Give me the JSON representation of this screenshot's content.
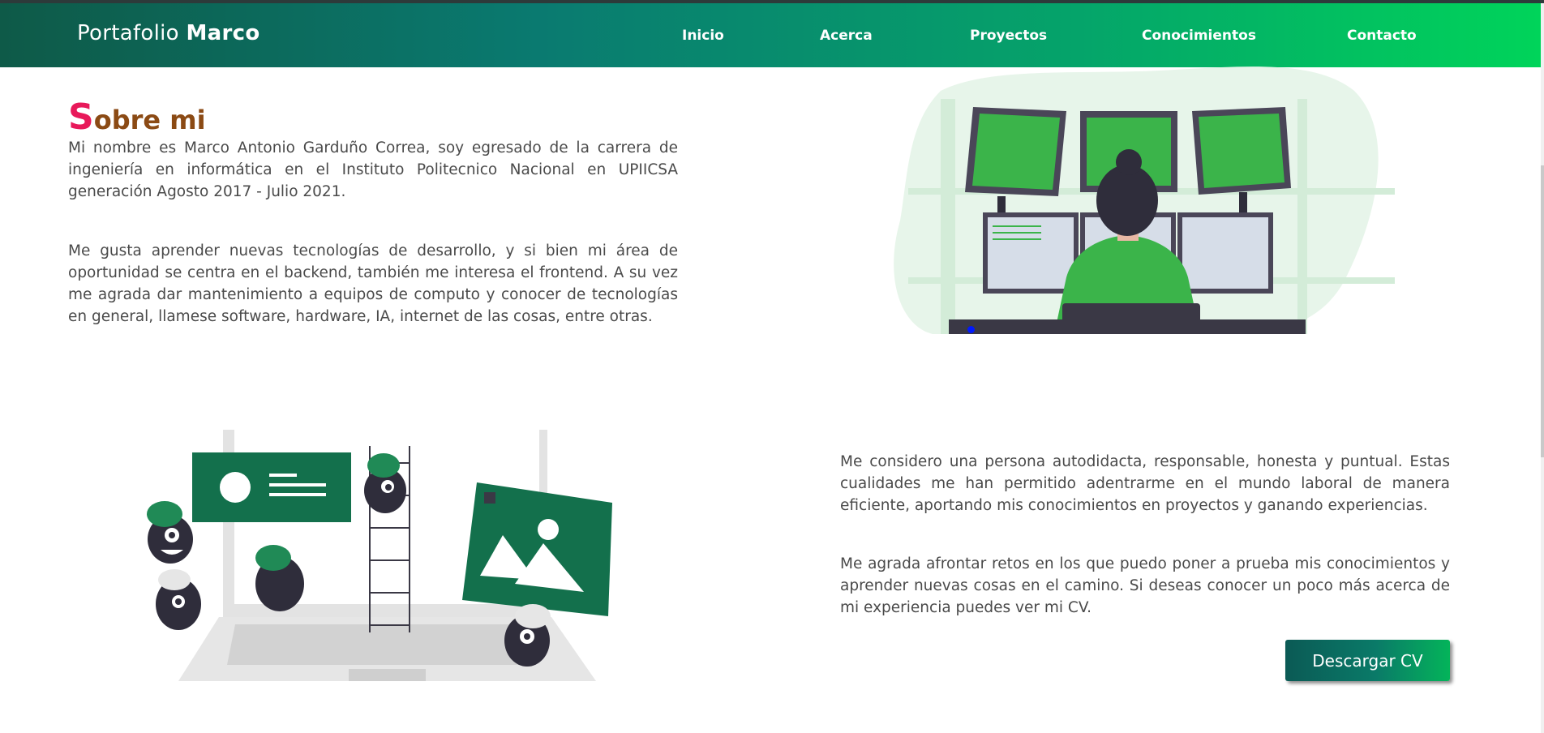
{
  "nav": {
    "brand_light": "Portafolio",
    "brand_bold": "Marco",
    "links": [
      "Inicio",
      "Acerca",
      "Proyectos",
      "Conocimientos",
      "Contacto"
    ]
  },
  "about": {
    "title_first": "S",
    "title_rest": "obre mi",
    "paragraphs": [
      "Mi nombre es Marco Antonio Garduño Correa, soy egresado de la carrera de ingeniería en informática en el Instituto Politecnico Nacional en UPIICSA generación Agosto 2017 - Julio 2021.",
      "Me gusta aprender nuevas tecnologías de desarrollo, y si bien mi área de oportunidad se centra en el backend, también me interesa el frontend. A su vez me agrada dar mantenimiento a equipos de computo y conocer de tecnologías en general, llamese software, hardware, IA, internet de las cosas, entre otras.",
      "Me considero una persona autodidacta, responsable, honesta y puntual. Estas cualidades me han permitido adentrarme en el mundo laboral de manera eficiente, aportando mis conocimientos en proyectos y ganando experiencias.",
      "Me agrada afrontar retos en los que puedo poner a prueba mis conocimientos y aprender nuevas cosas en el camino. Si deseas conocer un poco más acerca de mi experiencia puedes ver mi CV."
    ],
    "cv_button": "Descargar CV"
  },
  "colors": {
    "nav_start": "#0e5a48",
    "nav_end": "#00d45a",
    "title_initial": "#e8195a",
    "title_rest": "#8b4a14",
    "illustration_green": "#3bb44a",
    "illustration_dark_green": "#13704c"
  }
}
